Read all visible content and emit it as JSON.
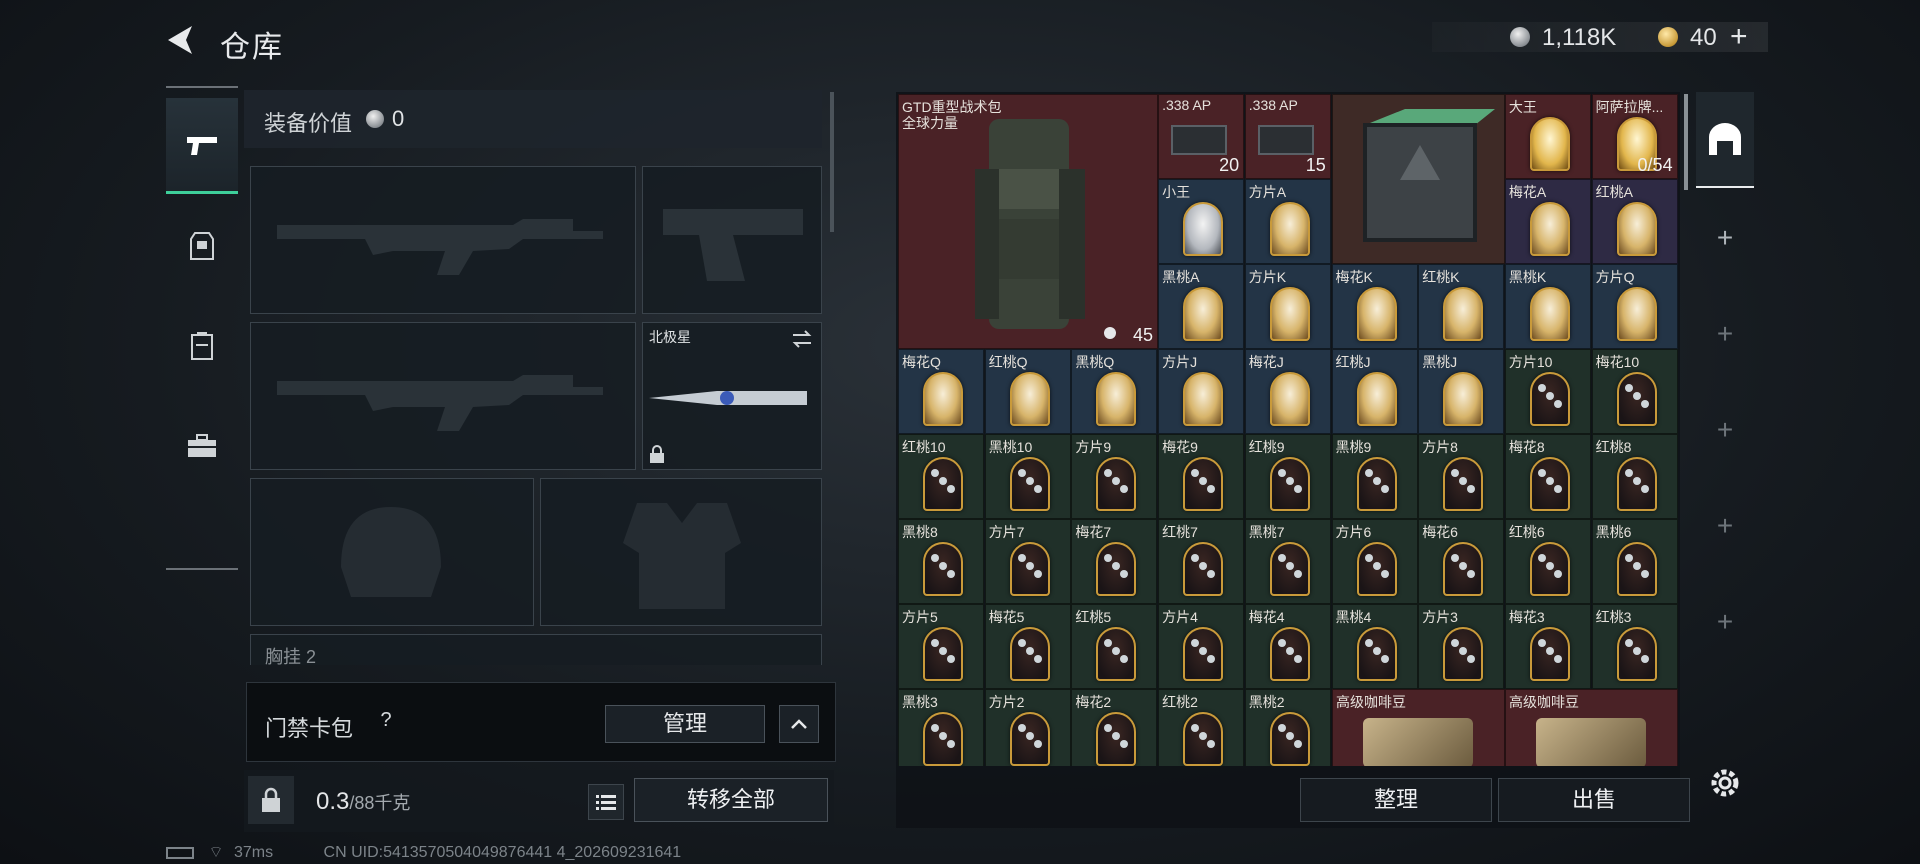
{
  "header": {
    "title": "仓库"
  },
  "currency": {
    "silver": "1,118K",
    "gold": "40",
    "gold_add": "+"
  },
  "equipment": {
    "value_label": "装备价值",
    "value": "0",
    "melee_slot_name": "北极星",
    "chest_label": "胸挂  2"
  },
  "keycard": {
    "label": "门禁卡包",
    "help": "?",
    "manage": "管理"
  },
  "capacity": {
    "current": "0.3",
    "max": "/88千克",
    "transfer_all": "转移全部"
  },
  "status": {
    "ping": "37ms",
    "uid": "CN UID:5413570504049876441 4_202609231641"
  },
  "inventory": {
    "backpack": {
      "name": "GTD重型战术包",
      "subname": "全球力量",
      "count": "45"
    },
    "items": [
      {
        "name": ".338 AP",
        "count": "20",
        "bg": "red",
        "type": "ammo"
      },
      {
        "name": ".338 AP",
        "count": "15",
        "bg": "red",
        "type": "ammo"
      },
      {
        "name": "大王",
        "count": "",
        "bg": "red",
        "type": "joker-big"
      },
      {
        "name": "阿萨拉牌...",
        "count": "0/54",
        "bg": "red",
        "type": "joker-big"
      },
      {
        "name": "小王",
        "count": "",
        "bg": "blue",
        "type": "joker-small"
      },
      {
        "name": "方片A",
        "count": "",
        "bg": "blue",
        "type": "face"
      },
      {
        "name": "梅花A",
        "count": "",
        "bg": "purple",
        "type": "face"
      },
      {
        "name": "红桃A",
        "count": "",
        "bg": "purple",
        "type": "face"
      },
      {
        "name": "黑桃A",
        "count": "",
        "bg": "blue",
        "type": "face"
      },
      {
        "name": "方片K",
        "count": "",
        "bg": "blue",
        "type": "face"
      },
      {
        "name": "梅花K",
        "count": "",
        "bg": "blue",
        "type": "face"
      },
      {
        "name": "红桃K",
        "count": "",
        "bg": "blue",
        "type": "face"
      },
      {
        "name": "黑桃K",
        "count": "",
        "bg": "blue",
        "type": "face"
      },
      {
        "name": "方片Q",
        "count": "",
        "bg": "blue",
        "type": "face"
      },
      {
        "name": "梅花Q",
        "count": "",
        "bg": "blue",
        "type": "face"
      },
      {
        "name": "红桃Q",
        "count": "",
        "bg": "blue",
        "type": "face"
      },
      {
        "name": "黑桃Q",
        "count": "",
        "bg": "blue",
        "type": "face"
      },
      {
        "name": "方片J",
        "count": "",
        "bg": "blue",
        "type": "face"
      },
      {
        "name": "梅花J",
        "count": "",
        "bg": "blue",
        "type": "face"
      },
      {
        "name": "红桃J",
        "count": "",
        "bg": "blue",
        "type": "face"
      },
      {
        "name": "黑桃J",
        "count": "",
        "bg": "blue",
        "type": "face"
      },
      {
        "name": "方片10",
        "count": "",
        "bg": "green",
        "type": "num"
      },
      {
        "name": "梅花10",
        "count": "",
        "bg": "green",
        "type": "num"
      },
      {
        "name": "红桃10",
        "count": "",
        "bg": "green",
        "type": "num"
      },
      {
        "name": "黑桃10",
        "count": "",
        "bg": "green",
        "type": "num"
      },
      {
        "name": "方片9",
        "count": "",
        "bg": "green",
        "type": "num"
      },
      {
        "name": "梅花9",
        "count": "",
        "bg": "green",
        "type": "num"
      },
      {
        "name": "红桃9",
        "count": "",
        "bg": "green",
        "type": "num"
      },
      {
        "name": "黑桃9",
        "count": "",
        "bg": "green",
        "type": "num"
      },
      {
        "name": "方片8",
        "count": "",
        "bg": "green",
        "type": "num"
      },
      {
        "name": "梅花8",
        "count": "",
        "bg": "green",
        "type": "num"
      },
      {
        "name": "红桃8",
        "count": "",
        "bg": "green",
        "type": "num"
      },
      {
        "name": "黑桃8",
        "count": "",
        "bg": "green",
        "type": "num"
      },
      {
        "name": "方片7",
        "count": "",
        "bg": "green",
        "type": "num"
      },
      {
        "name": "梅花7",
        "count": "",
        "bg": "green",
        "type": "num"
      },
      {
        "name": "红桃7",
        "count": "",
        "bg": "green",
        "type": "num"
      },
      {
        "name": "黑桃7",
        "count": "",
        "bg": "green",
        "type": "num"
      },
      {
        "name": "方片6",
        "count": "",
        "bg": "green",
        "type": "num"
      },
      {
        "name": "梅花6",
        "count": "",
        "bg": "green",
        "type": "num"
      },
      {
        "name": "红桃6",
        "count": "",
        "bg": "green",
        "type": "num"
      },
      {
        "name": "黑桃6",
        "count": "",
        "bg": "green",
        "type": "num"
      },
      {
        "name": "方片5",
        "count": "",
        "bg": "green",
        "type": "num"
      },
      {
        "name": "梅花5",
        "count": "",
        "bg": "green",
        "type": "num"
      },
      {
        "name": "红桃5",
        "count": "",
        "bg": "green",
        "type": "num"
      },
      {
        "name": "方片4",
        "count": "",
        "bg": "green",
        "type": "num"
      },
      {
        "name": "梅花4",
        "count": "",
        "bg": "green",
        "type": "num"
      },
      {
        "name": "黑桃4",
        "count": "",
        "bg": "green",
        "type": "num"
      },
      {
        "name": "方片3",
        "count": "",
        "bg": "green",
        "type": "num"
      },
      {
        "name": "梅花3",
        "count": "",
        "bg": "green",
        "type": "num"
      },
      {
        "name": "红桃3",
        "count": "",
        "bg": "green",
        "type": "num"
      },
      {
        "name": "黑桃3",
        "count": "",
        "bg": "green",
        "type": "num"
      },
      {
        "name": "方片2",
        "count": "",
        "bg": "green",
        "type": "num"
      },
      {
        "name": "梅花2",
        "count": "",
        "bg": "green",
        "type": "num"
      },
      {
        "name": "红桃2",
        "count": "",
        "bg": "green",
        "type": "num"
      },
      {
        "name": "黑桃2",
        "count": "",
        "bg": "green",
        "type": "num"
      }
    ],
    "coffee_1": "高级咖啡豆",
    "coffee_2": "高级咖啡豆",
    "sort": "整理",
    "sell": "出售"
  },
  "right_tabs": {
    "add": "+"
  }
}
